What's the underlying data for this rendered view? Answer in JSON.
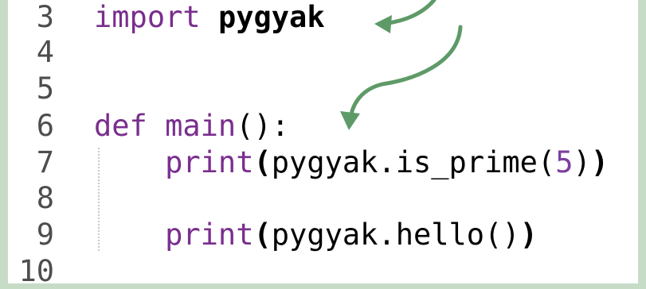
{
  "editor": {
    "lines": [
      {
        "num": "3",
        "tokens": [
          {
            "t": "import ",
            "c": "kw"
          },
          {
            "t": "pygyak",
            "c": "bold"
          }
        ]
      },
      {
        "num": "4",
        "tokens": []
      },
      {
        "num": "5",
        "tokens": []
      },
      {
        "num": "6",
        "tokens": [
          {
            "t": "def ",
            "c": "kw"
          },
          {
            "t": "main",
            "c": "kw"
          },
          {
            "t": "():",
            "c": "plain"
          }
        ]
      },
      {
        "num": "7",
        "tokens": [
          {
            "t": "    print",
            "c": "kw"
          },
          {
            "t": "(",
            "c": "bold"
          },
          {
            "t": "pygyak.is_prime(",
            "c": "plain"
          },
          {
            "t": "5",
            "c": "numlit"
          },
          {
            "t": ")",
            "c": "plain"
          },
          {
            "t": ")",
            "c": "bold"
          }
        ]
      },
      {
        "num": "8",
        "tokens": []
      },
      {
        "num": "9",
        "tokens": [
          {
            "t": "    print",
            "c": "kw"
          },
          {
            "t": "(",
            "c": "bold"
          },
          {
            "t": "pygyak.hello()",
            "c": "plain"
          },
          {
            "t": ")",
            "c": "bold"
          }
        ]
      },
      {
        "num": "10",
        "tokens": []
      }
    ]
  },
  "colors": {
    "keyword": "#7a2e8e",
    "arrow": "#5e9a67",
    "background_frame": "#c7dcc7"
  },
  "icons": [
    "curved-arrow-icon"
  ]
}
